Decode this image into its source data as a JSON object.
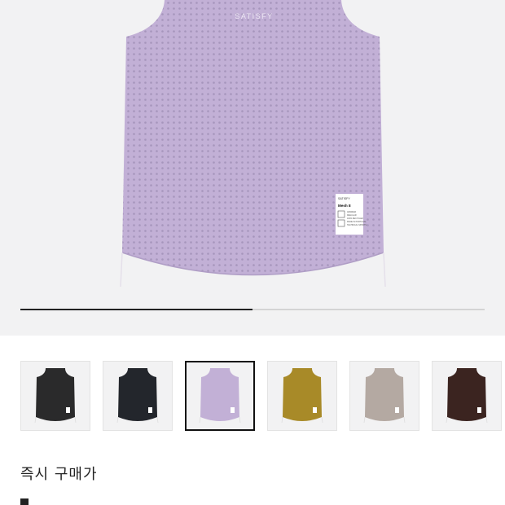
{
  "product_image": {
    "color": "#c2b0d6",
    "logo_text": "SATISFY",
    "care_label": {
      "brand": "SATISFY",
      "product": "Mesh 8",
      "lines": [
        "AIRWEAR",
        "REGULAR",
        "100% RECYCLED",
        "MADE IN PORTUGAL",
        "TECHNICAL SPORTS"
      ]
    }
  },
  "carousel": {
    "progress": 0.5
  },
  "colors": [
    {
      "name": "black",
      "hex": "#2a2a2b",
      "selected": false
    },
    {
      "name": "navy-black",
      "hex": "#23262c",
      "selected": false
    },
    {
      "name": "lavender",
      "hex": "#c2b0d6",
      "selected": true
    },
    {
      "name": "mustard",
      "hex": "#a88a28",
      "selected": false
    },
    {
      "name": "taupe",
      "hex": "#b4a9a2",
      "selected": false
    },
    {
      "name": "dark-brown",
      "hex": "#3b2420",
      "selected": false
    }
  ],
  "purchase": {
    "instant_label": "즉시 구매가"
  }
}
